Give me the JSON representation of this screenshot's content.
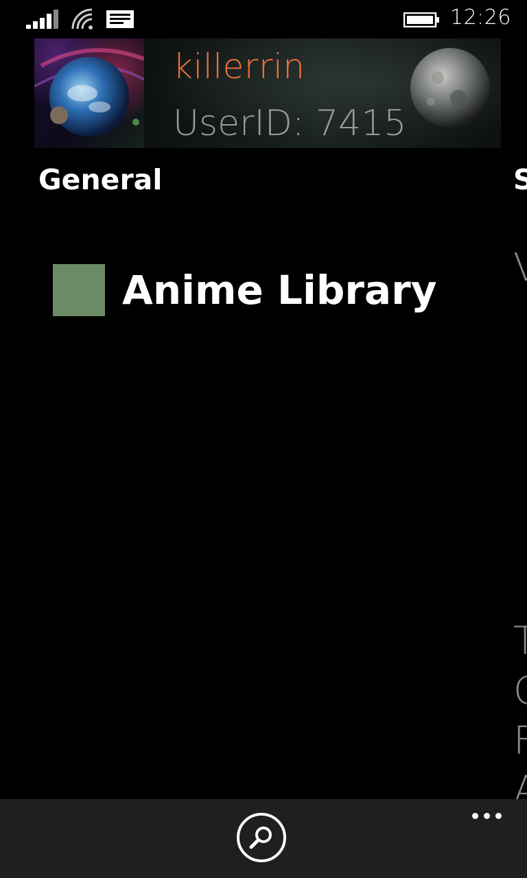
{
  "status_bar": {
    "time": "12:26",
    "icons": [
      "signal-icon",
      "wifi-icon",
      "message-icon",
      "battery-icon"
    ]
  },
  "profile": {
    "username": "killerrin",
    "user_id": "UserID: 7415",
    "accent_color": "#f0703a"
  },
  "pivot": {
    "current": "General",
    "next_peek": "S"
  },
  "tiles": [
    {
      "label": "Anime Library",
      "color": "#6c8b64"
    }
  ],
  "next_panel_peek": [
    "V",
    "T",
    "C",
    "F",
    "A"
  ],
  "app_bar": {
    "buttons": [
      "search-icon"
    ],
    "more": "more-icon"
  }
}
